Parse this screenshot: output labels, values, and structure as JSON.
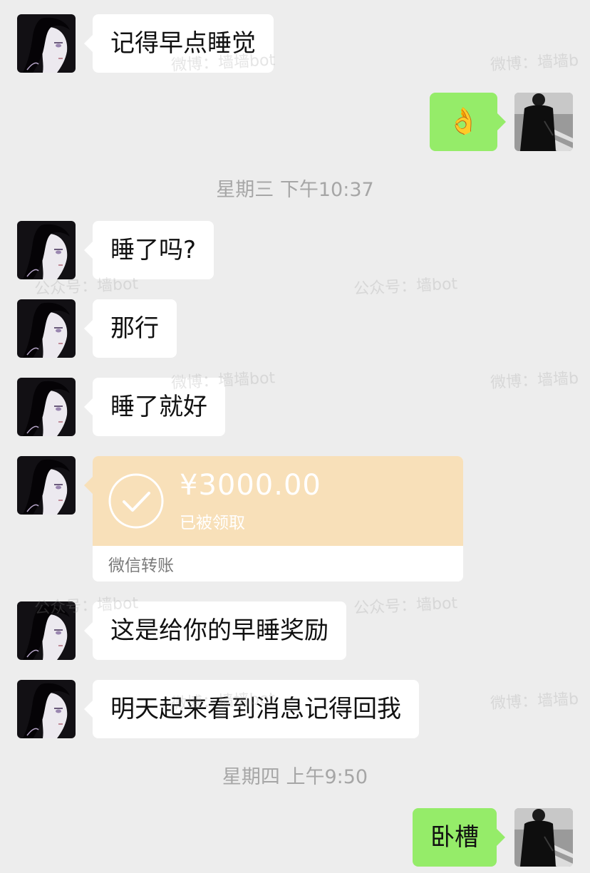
{
  "messages": [
    {
      "side": "in",
      "text": "记得早点睡觉"
    },
    {
      "side": "out",
      "text": "👌"
    },
    {
      "type": "time",
      "text": "星期三 下午10:37"
    },
    {
      "side": "in",
      "text": "睡了吗?"
    },
    {
      "side": "in",
      "text": "那行"
    },
    {
      "side": "in",
      "text": "睡了就好"
    },
    {
      "side": "in",
      "type": "transfer"
    },
    {
      "side": "in",
      "text": "这是给你的早睡奖励"
    },
    {
      "side": "in",
      "text": "明天起来看到消息记得回我"
    },
    {
      "type": "time",
      "text": "星期四 上午9:50"
    },
    {
      "side": "out",
      "text": "卧槽"
    }
  ],
  "transfer": {
    "amount": "¥3000.00",
    "status": "已被领取",
    "label": "微信转账"
  },
  "watermarks": {
    "weibo": "微博：墙墙bot",
    "weibo_cut": "微博：墙墙b",
    "gzh": "公众号：墙bot"
  },
  "colors": {
    "background": "#ededed",
    "incoming_bubble": "#ffffff",
    "outgoing_bubble": "#95ec69",
    "transfer_card": "#f8e0b9",
    "time_text": "#a6a6a6"
  }
}
